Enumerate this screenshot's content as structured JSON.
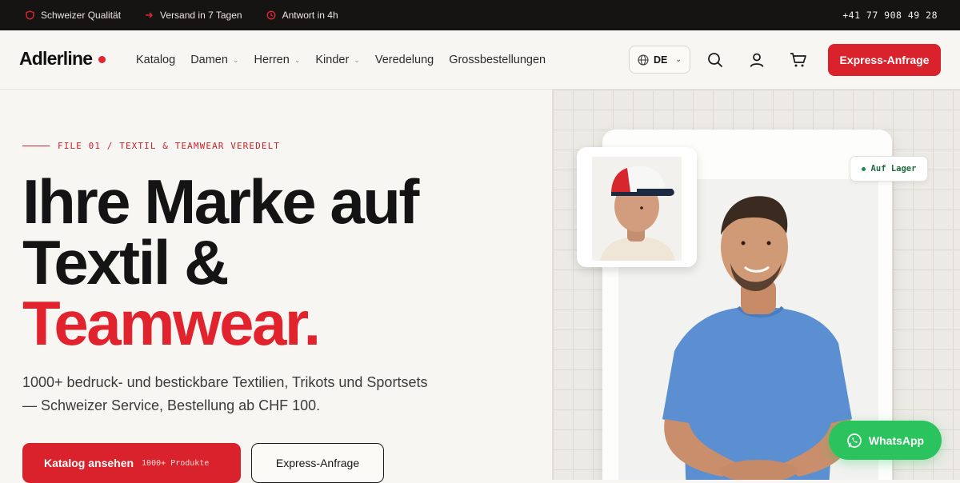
{
  "topbar": {
    "items": [
      {
        "icon": "shield-icon",
        "label": "Schweizer Qualität"
      },
      {
        "icon": "arrow-right-icon",
        "label": "Versand in 7 Tagen"
      },
      {
        "icon": "clock-icon",
        "label": "Antwort in 4h"
      }
    ],
    "phone": "+41 77 908 49 28"
  },
  "header": {
    "logo": "Adlerline",
    "nav": [
      {
        "label": "Katalog",
        "dropdown": false
      },
      {
        "label": "Damen",
        "dropdown": true
      },
      {
        "label": "Herren",
        "dropdown": true
      },
      {
        "label": "Kinder",
        "dropdown": true
      },
      {
        "label": "Veredelung",
        "dropdown": false
      },
      {
        "label": "Grossbestellungen",
        "dropdown": false
      }
    ],
    "language": "DE",
    "icons": [
      "search-icon",
      "user-icon",
      "cart-icon"
    ],
    "cta": "Express-Anfrage"
  },
  "hero": {
    "eyebrow": "FILE 01 / TEXTIL & TEAMWEAR VEREDELT",
    "headline_line1": "Ihre Marke auf",
    "headline_line2": "Textil &",
    "headline_line3": "Teamwear.",
    "subtext": "1000+ bedruck- und bestickbare Textilien, Trikots und Sportsets — Schweizer Service, Bestellung ab CHF 100.",
    "primary_button": "Katalog ansehen",
    "primary_badge": "1000+ Produkte",
    "secondary_button": "Express-Anfrage",
    "stock_badge": "Auf Lager",
    "whatsapp": "WhatsApp"
  },
  "colors": {
    "accent": "#d9222b",
    "topbar_bg": "#161413",
    "whatsapp": "#2bc35e",
    "stock_green": "#1f6b3d"
  }
}
